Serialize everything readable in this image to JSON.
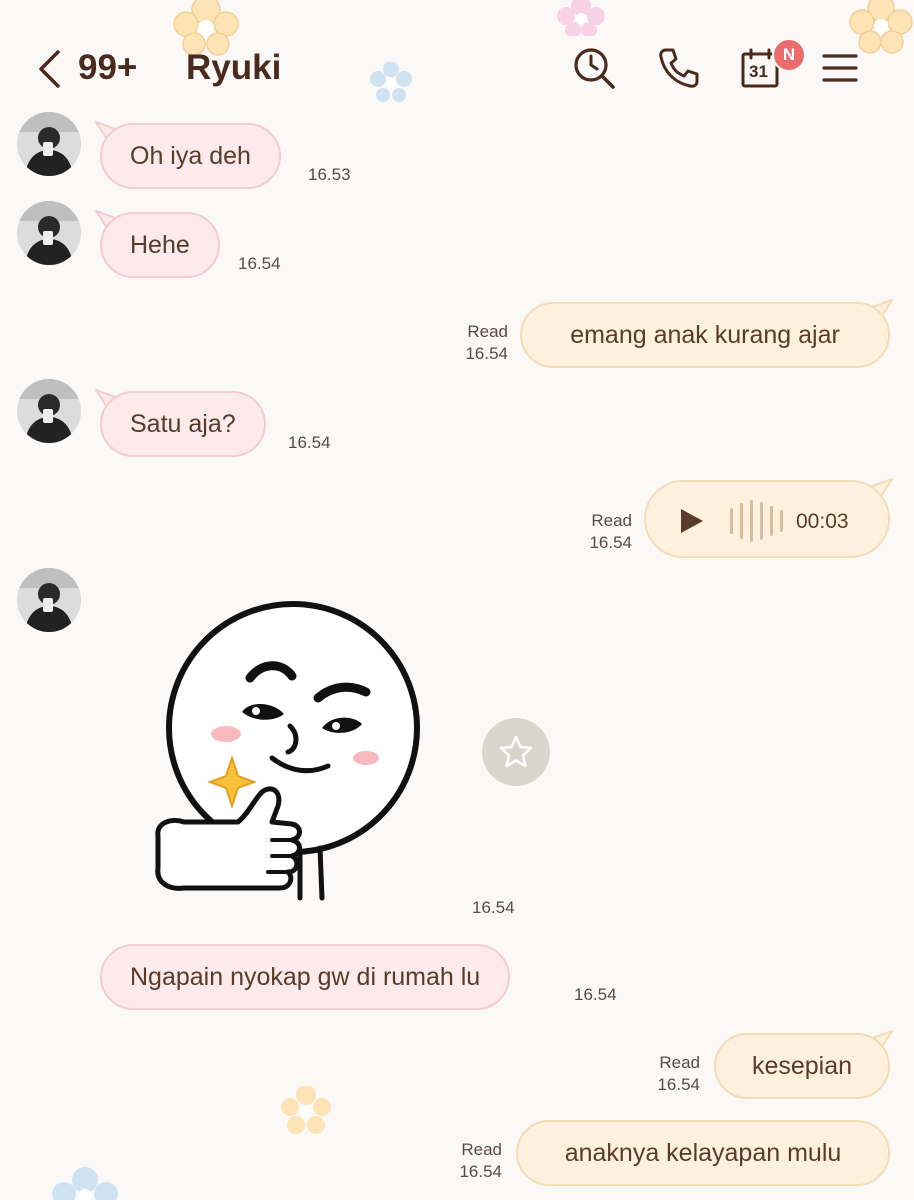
{
  "header": {
    "back_icon": "chevron-left-icon",
    "unread_count": "99+",
    "title": "Ryuki",
    "calendar_day": "31",
    "calendar_badge": "N",
    "icons": [
      "search-clock-icon",
      "phone-icon",
      "calendar-icon",
      "menu-icon"
    ]
  },
  "messages": [
    {
      "side": "in",
      "text": "Oh iya deh",
      "time": "16.53"
    },
    {
      "side": "in",
      "text": "Hehe",
      "time": "16.54"
    },
    {
      "side": "out",
      "text": "emang anak kurang ajar",
      "status": "Read",
      "time": "16.54"
    },
    {
      "side": "in",
      "text": "Satu aja?",
      "time": "16.54"
    },
    {
      "side": "out",
      "type": "voice",
      "duration": "00:03",
      "status": "Read",
      "time": "16.54"
    },
    {
      "side": "in",
      "type": "sticker",
      "sticker": "thumbs-up-sticker",
      "time": "16.54"
    },
    {
      "side": "in",
      "text": "Ngapain nyokap gw di rumah lu",
      "time": "16.54"
    },
    {
      "side": "out",
      "text": "kesepian",
      "status": "Read",
      "time": "16.54"
    },
    {
      "side": "out",
      "text": "anaknya kelayapan mulu",
      "status": "Read",
      "time": "16.54"
    }
  ],
  "colors": {
    "incoming_bubble": "#fdeaea",
    "outgoing_bubble": "#fff1dd",
    "badge": "#ea6d6d",
    "text": "#5a3b2b"
  }
}
